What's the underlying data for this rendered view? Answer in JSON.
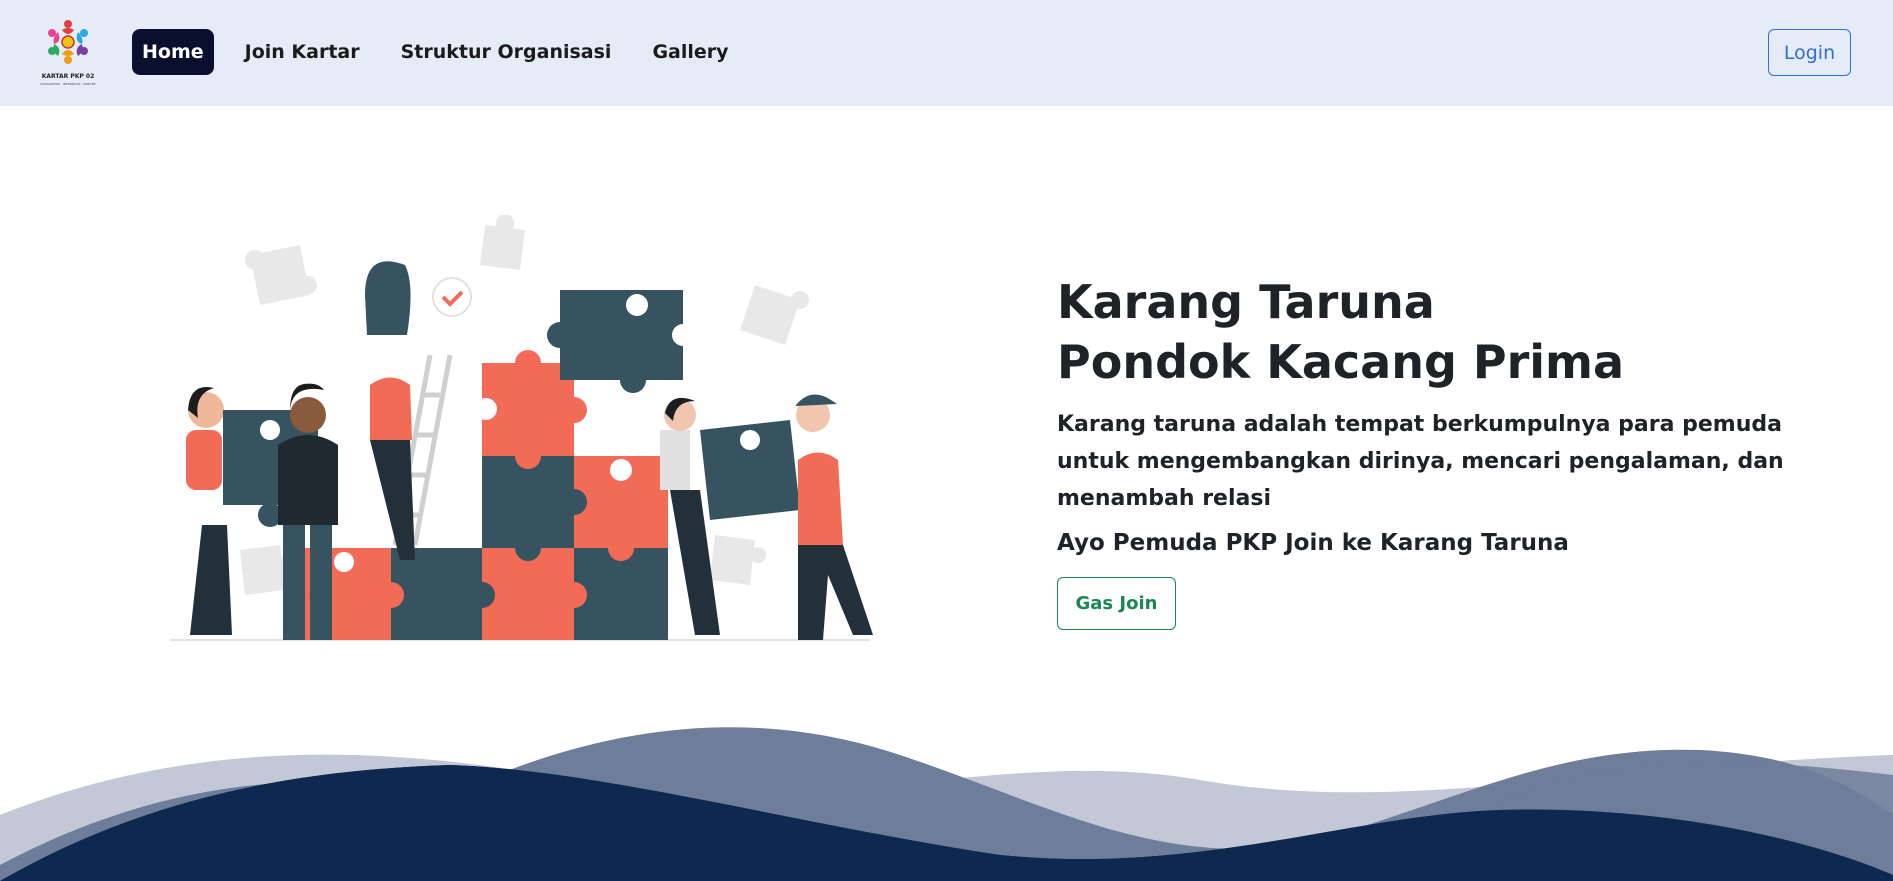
{
  "nav": {
    "logo_text": "KARTAR PKP 02",
    "logo_subtext": "SOLIDARITAS · INTEGRITAS · KREATIF",
    "items": [
      {
        "label": "Home",
        "active": true
      },
      {
        "label": "Join Kartar"
      },
      {
        "label": "Struktur Organisasi"
      },
      {
        "label": "Gallery"
      }
    ],
    "login_label": "Login"
  },
  "hero": {
    "title_line1": "Karang Taruna",
    "title_line2": "Pondok Kacang Prima",
    "description": "Karang taruna adalah tempat berkumpulnya para pemuda untuk mengembangkan dirinya, mencari pengalaman, dan menambah relasi",
    "cta_text": "Ayo Pemuda PKP Join ke Karang Taruna",
    "cta_button": "Gas Join",
    "illustration_icon": "team-puzzle-illustration"
  },
  "colors": {
    "navbar_bg": "#e6ecf7",
    "active_nav_bg": "#0b0f2e",
    "login_accent": "#2f6fd6",
    "join_accent": "#198754",
    "puzzle_red": "#f26b57",
    "puzzle_dark": "#37535f",
    "wave_dark": "#0f2850"
  }
}
